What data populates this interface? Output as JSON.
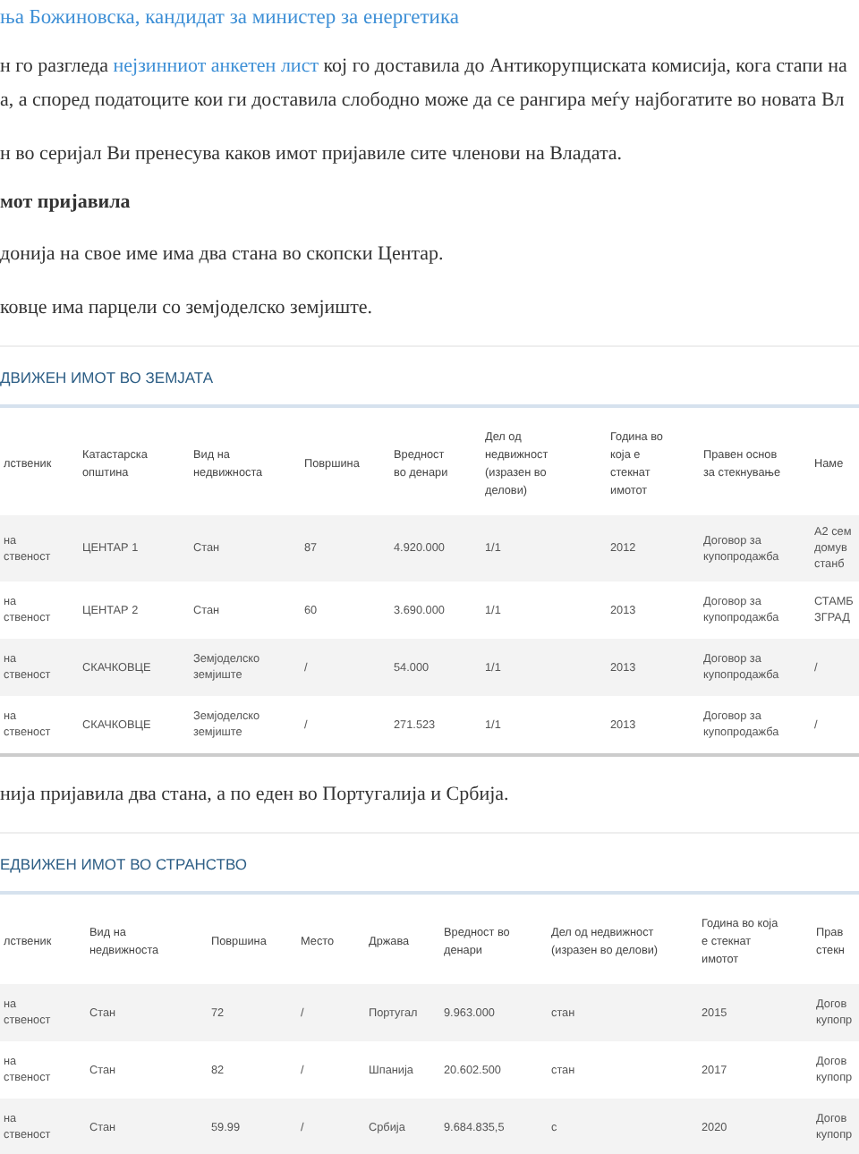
{
  "blocks": [
    {
      "kind": "link",
      "text": "ња Божиновска, кандидат за министер за енергетика"
    },
    {
      "kind": "paragraph",
      "lines": [
        [
          {
            "text": "н го разгледа ",
            "link": false
          },
          {
            "text": "нејзинниот анкетен лист",
            "link": true
          },
          {
            "text": " кој го доставила до Антикорупциската комисија, кога стапи на",
            "link": false
          }
        ],
        [
          {
            "text": "а, а според податоците кои ги доставила слободно може да се рангира меѓу најбогатите во новата Вл",
            "link": false
          }
        ]
      ]
    },
    {
      "kind": "paragraph",
      "lines": [
        [
          {
            "text": "н во серијал Ви пренесува каков имот пријавиле сите членови на Владата.",
            "link": false
          }
        ]
      ]
    },
    {
      "kind": "heading",
      "text": "мот пријавила"
    },
    {
      "kind": "paragraph",
      "lines": [
        [
          {
            "text": "донија на свое име има два стана во скопски Центар.",
            "link": false
          }
        ]
      ]
    },
    {
      "kind": "paragraph",
      "lines": [
        [
          {
            "text": "ковце има парцели со земјоделско земјиште.",
            "link": false
          }
        ]
      ]
    },
    {
      "kind": "table",
      "title": "ДВИЖЕН ИМОТ ВО ЗЕМЈАТА",
      "columns": [
        "лственик",
        "Катастарска\nопштина",
        "Вид на\nнедвижноста",
        "Површина",
        "Вредност\nво денари",
        "Дел од\nнедвижност\n(изразен во\nделови)",
        "Година во\nкоја е\nстекнат\nимотот",
        "Правен основ\nза стекнување",
        "Наме"
      ],
      "rows": [
        [
          "на\nственост",
          "ЦЕНТАР 1",
          "Стан",
          "87",
          "4.920.000",
          "1/1",
          "2012",
          "Договор за\nкупопродажба",
          "А2 сем\nдомув\nстанб"
        ],
        [
          "на\nственост",
          "ЦЕНТАР 2",
          "Стан",
          "60",
          "3.690.000",
          "1/1",
          "2013",
          "Договор за\nкупопродажба",
          "СТАМБ\nЗГРАД"
        ],
        [
          "на\nственост",
          "СКАЧКОВЦЕ",
          "Земјоделско\nземјиште",
          "/",
          "54.000",
          "1/1",
          "2013",
          "Договор за\nкупопродажба",
          "/"
        ],
        [
          "на\nственост",
          "СКАЧКОВЦЕ",
          "Земјоделско\nземјиште",
          "/",
          "271.523",
          "1/1",
          "2013",
          "Договор за\nкупопродажба",
          "/"
        ]
      ]
    },
    {
      "kind": "paragraph",
      "lines": [
        [
          {
            "text": "нија пријавила два стана, а по еден во Португалија и Србија.",
            "link": false
          }
        ]
      ]
    },
    {
      "kind": "table",
      "title": "ЕДВИЖЕН ИМОТ ВО СТРАНСТВО",
      "columns": [
        "лственик",
        "Вид на\nнедвижноста",
        "Површина",
        "Место",
        "Држава",
        "Вредност во\nденари",
        "Дел од недвижност\n(изразен во делови)",
        "Година во која\nе стекнат\nимотот",
        "Прав\nстекн"
      ],
      "rows": [
        [
          "на\nственост",
          "Стан",
          "72",
          "/",
          "Португал",
          "9.963.000",
          "стан",
          "2015",
          "Догов\nкупопр"
        ],
        [
          "на\nственост",
          "Стан",
          "82",
          "/",
          "Шпанија",
          "20.602.500",
          "стан",
          "2017",
          "Догов\nкупопр"
        ],
        [
          "на\nственост",
          "Стан",
          "59.99",
          "/",
          "Србија",
          "9.684.835,5",
          "с",
          "2020",
          "Догов\nкупопр"
        ]
      ]
    }
  ]
}
